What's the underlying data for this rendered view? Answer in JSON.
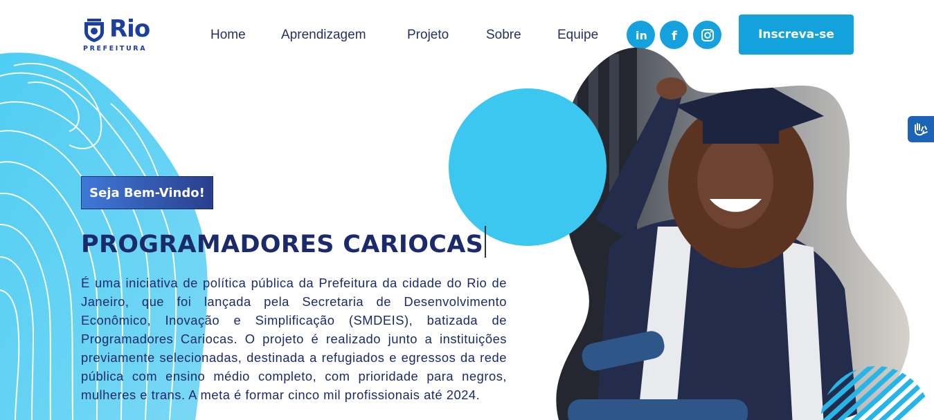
{
  "header": {
    "logo": {
      "name": "Rio",
      "subtitle": "PREFEITURA"
    },
    "nav": [
      {
        "label": "Home"
      },
      {
        "label": "Aprendizagem"
      },
      {
        "label": "Projeto"
      },
      {
        "label": "Sobre"
      },
      {
        "label": "Equipe"
      }
    ],
    "social": [
      {
        "icon": "linkedin-icon",
        "label": "in"
      },
      {
        "icon": "facebook-icon",
        "label": "f"
      },
      {
        "icon": "instagram-icon"
      }
    ],
    "cta_label": "Inscreva-se"
  },
  "hero": {
    "badge": "Seja Bem-Vindo!",
    "title": "PROGRAMADORES CARIOCAS",
    "description": "É uma iniciativa de política pública da Prefeitura da cidade do Rio de Janeiro, que foi lançada pela Secretaria de Desenvolvimento Econômico, Inovação e Simplificação (SMDEIS), batizada de Programadores Cariocas. O projeto é realizado junto a instituições previamente selecionadas, destinada a refugiados e egressos da rede pública com ensino médio completo, com prioridade para negros, mulheres e trans. A meta é formar cinco mil profissionais até 2024."
  },
  "accessibility": {
    "icon": "sign-language-hands-icon"
  },
  "colors": {
    "primary_blue": "#13a2dc",
    "navy": "#1b2a6b",
    "circle": "#3cc7f1",
    "topo": "#5fd0f2"
  }
}
